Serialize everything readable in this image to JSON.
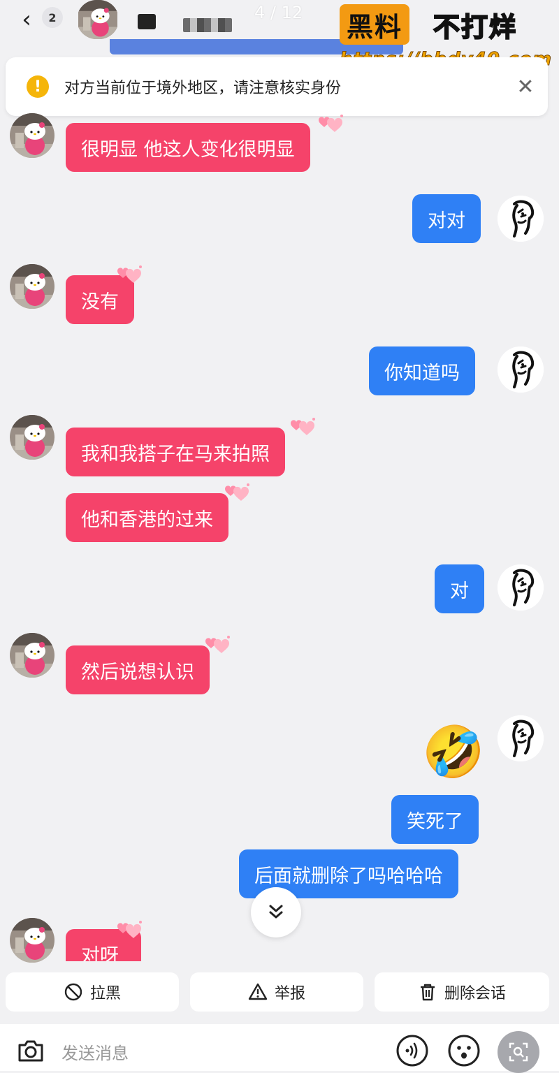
{
  "header": {
    "back_icon": "chevron-left-icon",
    "unread_count": "2",
    "contact_name_obscured": "",
    "pager": "4 / 12"
  },
  "watermark": {
    "box_text": "黑料",
    "tail_text": "不打烊",
    "url": "https://bbdy40.com"
  },
  "notice": {
    "icon": "warning-circle-icon",
    "text": "对方当前位于境外地区，请注意核实身份",
    "close_icon": "close-icon"
  },
  "messages": [
    {
      "side": "them",
      "text": "很明显 他这人变化很明显"
    },
    {
      "side": "me",
      "text": "对对"
    },
    {
      "side": "them",
      "text": "没有"
    },
    {
      "side": "me",
      "text": "你知道吗"
    },
    {
      "side": "them",
      "text": "我和我搭子在马来拍照"
    },
    {
      "side": "them",
      "text": "他和香港的过来"
    },
    {
      "side": "me",
      "text": "对"
    },
    {
      "side": "them",
      "text": "然后说想认识"
    },
    {
      "side": "me",
      "emoji": "🤣"
    },
    {
      "side": "me",
      "text": "笑死了"
    },
    {
      "side": "me",
      "text": "后面就删除了吗哈哈哈"
    },
    {
      "side": "them",
      "text": "对呀"
    }
  ],
  "scroll_down_icon": "double-chevron-down-icon",
  "actions": [
    {
      "label": "拉黑",
      "icon": "block-icon"
    },
    {
      "label": "举报",
      "icon": "warning-triangle-icon"
    },
    {
      "label": "删除会话",
      "icon": "trash-icon"
    }
  ],
  "input": {
    "placeholder": "发送消息",
    "camera_icon": "camera-icon",
    "voice_icon": "voice-icon",
    "emoji_icon": "emoji-face-icon",
    "lens_icon": "lens-search-icon"
  },
  "colors": {
    "pink_bubble": "#f5436a",
    "blue_bubble": "#2f80f5",
    "background": "#f1f1f3",
    "warning": "#f5b50a",
    "watermark_orange": "#f39a12"
  }
}
